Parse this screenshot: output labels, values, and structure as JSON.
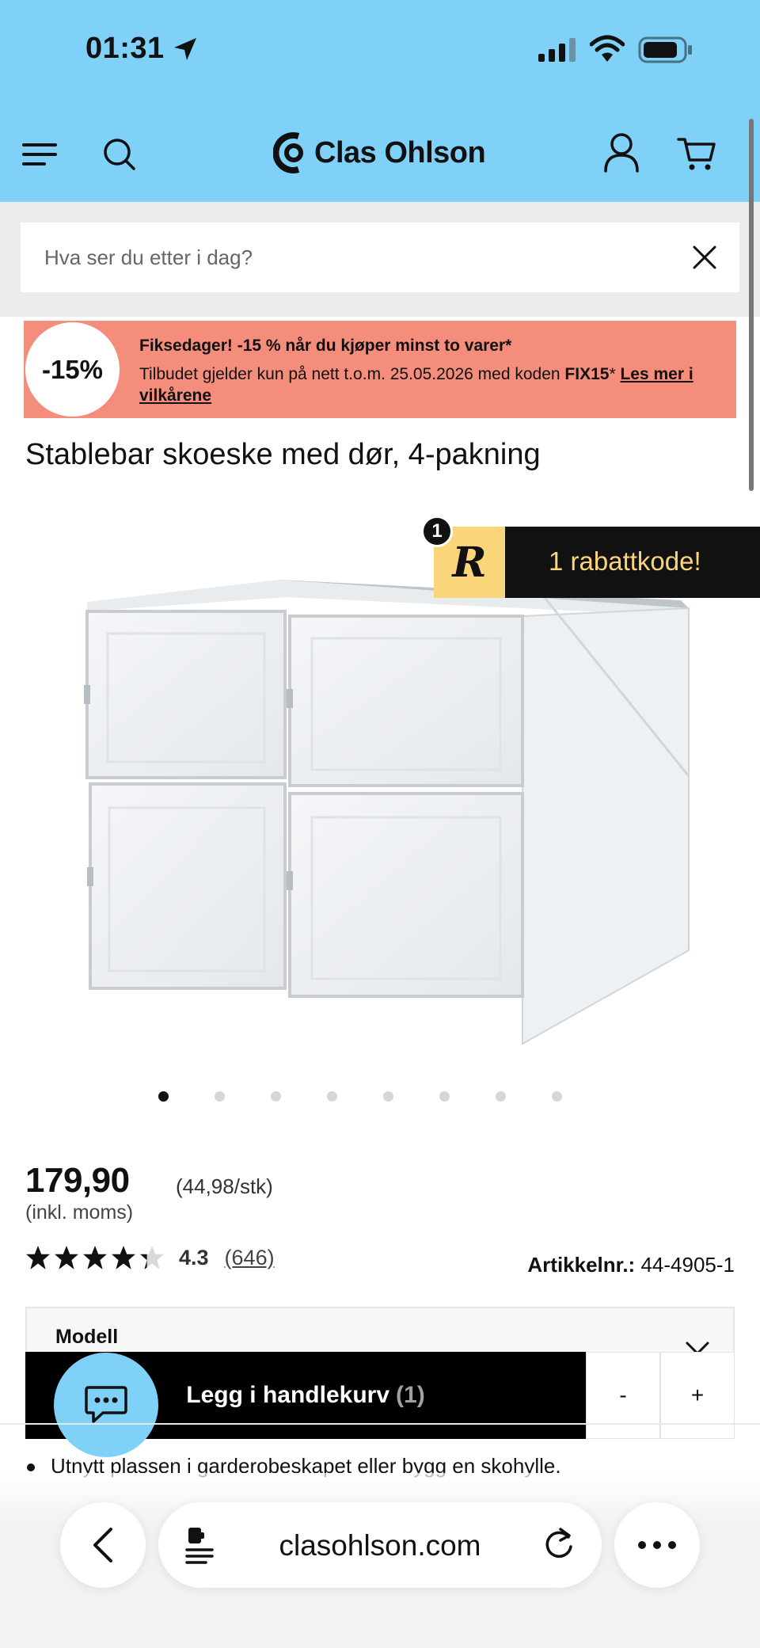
{
  "status_bar": {
    "time": "01:31"
  },
  "header": {
    "logo_text": "Clas Ohlson"
  },
  "search": {
    "placeholder": "Hva ser du etter i dag?"
  },
  "promo": {
    "badge": "-15%",
    "title": "Fiksedager! -15 % når du kjøper minst to varer*",
    "text": "Tilbudet gjelder kun på nett t.o.m. 25.05.2026 med koden ",
    "code": "FIX15",
    "code_suffix": "* ",
    "link": "Les mer i vilkårene"
  },
  "product": {
    "title": "Stablebar skoeske med dør, 4-pakning",
    "price": "179,90",
    "unit_price": "(44,98/stk)",
    "vat_note": "(inkl. moms)",
    "rating": {
      "value": "4.3",
      "count": "(646)",
      "stars_fraction": 0.86
    },
    "article_label": "Artikkelnr.:",
    "article_number": "44-4905-1",
    "image_count": 8,
    "active_image": 1
  },
  "rabatt": {
    "count": "1",
    "logo_letter": "R",
    "text": "1 rabattkode!"
  },
  "modell": {
    "label": "Modell"
  },
  "cart_bar": {
    "add_label": "Legg i handlekurv",
    "quantity": "(1)",
    "minus": "-",
    "plus": "+"
  },
  "description": {
    "bullets": [
      "Utnytt plassen i garderobeskapet eller bygg en skohylle."
    ]
  },
  "browser": {
    "url": "clasohlson.com"
  }
}
